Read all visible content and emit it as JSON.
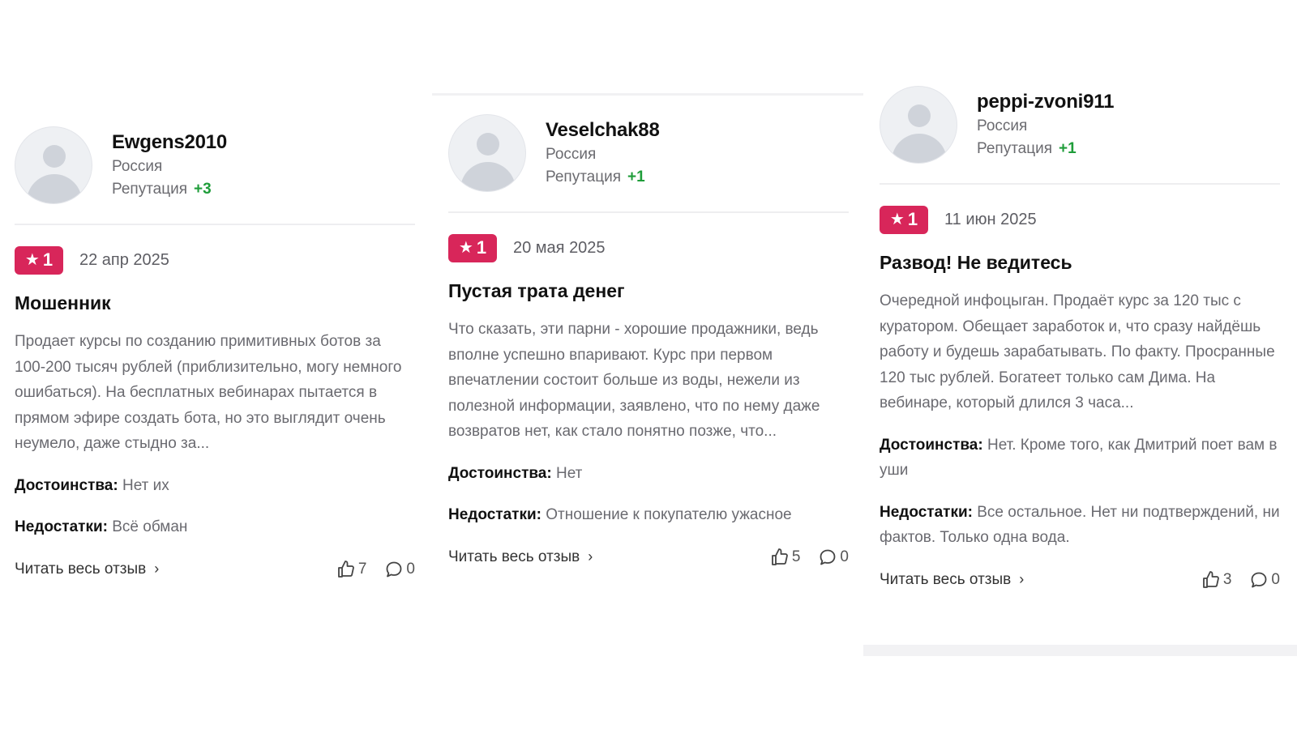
{
  "reviews": [
    {
      "username": "Ewgens2010",
      "country": "Россия",
      "reputation_label": "Репутация",
      "reputation_value": "+3",
      "rating": "1",
      "date": "22 апр 2025",
      "title": "Мошенник",
      "text": "Продает курсы по созданию примитивных ботов за 100-200 тысяч рублей (приблизительно, могу немного ошибаться). На бесплатных вебинарах пытается в прямом эфире создать бота, но это выглядит очень неумело, даже стыдно за...",
      "pros_label": "Достоинства:",
      "pros": "Нет их",
      "cons_label": "Недостатки:",
      "cons": "Всё обман",
      "read_more": "Читать весь отзыв",
      "likes": "7",
      "comments": "0"
    },
    {
      "username": "Veselchak88",
      "country": "Россия",
      "reputation_label": "Репутация",
      "reputation_value": "+1",
      "rating": "1",
      "date": "20 мая 2025",
      "title": "Пустая трата денег",
      "text": "Что сказать, эти парни - хорошие продажники, ведь вполне успешно впаривают. Курс при первом впечатлении состоит больше из воды, нежели из полезной информации, заявлено, что по нему даже возвратов нет, как стало понятно позже, что...",
      "pros_label": "Достоинства:",
      "pros": "Нет",
      "cons_label": "Недостатки:",
      "cons": "Отношение к покупателю ужасное",
      "read_more": "Читать весь отзыв",
      "likes": "5",
      "comments": "0"
    },
    {
      "username": "peppi-zvoni911",
      "country": "Россия",
      "reputation_label": "Репутация",
      "reputation_value": "+1",
      "rating": "1",
      "date": "11 июн 2025",
      "title": "Развод! Не ведитесь",
      "text": "Очередной инфоцыган. Продаёт курс за 120 тыс с куратором. Обещает заработок и, что сразу найдёшь работу и будешь зарабатывать. По факту. Просранные 120 тыс рублей. Богатеет только сам Дима. На вебинаре, который длился 3 часа...",
      "pros_label": "Достоинства:",
      "pros": "Нет. Кроме того, как Дмитрий поет вам в уши",
      "cons_label": "Недостатки:",
      "cons": "Все остальное. Нет ни подтверждений, ни фактов. Только одна вода.",
      "read_more": "Читать весь отзыв",
      "likes": "3",
      "comments": "0"
    }
  ],
  "colors": {
    "rating_badge": "#d8265a",
    "reputation_positive": "#1f9d3a"
  },
  "icons": [
    "user-avatar-placeholder",
    "star-icon",
    "chevron-right-icon",
    "thumbs-up-icon",
    "comment-icon"
  ]
}
